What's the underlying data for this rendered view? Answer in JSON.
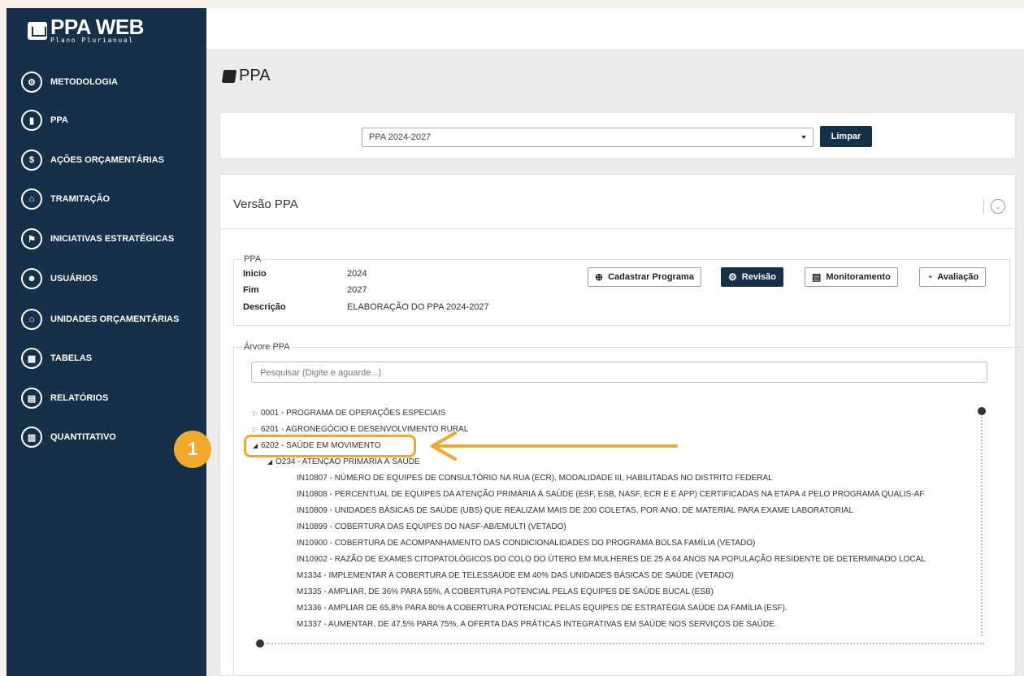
{
  "app": {
    "title": "PPA WEB",
    "subtitle": "Plano Plurianual"
  },
  "sidebar": {
    "items": [
      {
        "label": "METODOLOGIA",
        "icon": "cogs-icon",
        "glyph": "⚙"
      },
      {
        "label": "PPA",
        "icon": "book-icon",
        "glyph": "▮"
      },
      {
        "label": "AÇÕES ORÇAMENTÁRIAS",
        "icon": "dollar-icon",
        "glyph": "$"
      },
      {
        "label": "TRAMITAÇÃO",
        "icon": "inbox-icon",
        "glyph": "⌂"
      },
      {
        "label": "INICIATIVAS ESTRATÉGICAS",
        "icon": "sitemap-icon",
        "glyph": "⚑"
      },
      {
        "label": "USUÁRIOS",
        "icon": "users-icon",
        "glyph": "☻"
      },
      {
        "label": "UNIDADES ORÇAMENTÁRIAS",
        "icon": "bank-icon",
        "glyph": "⌂"
      },
      {
        "label": "TABELAS",
        "icon": "table-icon",
        "glyph": "▦"
      },
      {
        "label": "RELATÓRIOS",
        "icon": "file-icon",
        "glyph": "▤"
      },
      {
        "label": "QUANTITATIVO",
        "icon": "bar-chart-icon",
        "glyph": "▥"
      }
    ]
  },
  "page": {
    "title": "PPA"
  },
  "filter": {
    "selected": "PPA 2024-2027",
    "clear_label": "Limpar"
  },
  "versao": {
    "title": "Versão PPA",
    "buttons": {
      "cadastrar": "Cadastrar Programa",
      "revisao": "Revisão",
      "monitoramento": "Monitoramento",
      "avaliacao": "Avaliação"
    }
  },
  "ppa_info": {
    "legend": "PPA",
    "inicio_label": "Inicio",
    "inicio": "2024",
    "fim_label": "Fim",
    "fim": "2027",
    "descricao_label": "Descrição",
    "descricao": "ELABORAÇÃO DO PPA 2024-2027"
  },
  "tree": {
    "legend": "Árvore PPA",
    "search_placeholder": "Pesquisar (Digite e aguarde...)",
    "nodes": [
      "0001 - PROGRAMA DE OPERAÇÕES ESPECIAIS",
      "6201 - AGRONEGÓCIO E DESENVOLVIMENTO RURAL",
      "6202 - SAÚDE EM MOVIMENTO",
      "O234 - ATENÇÃO PRIMÁRIA À SAÚDE",
      "IN10807 - NÚMERO DE EQUIPES DE CONSULTÓRIO NA RUA (ECR), MODALIDADE III, HABILITADAS NO DISTRITO FEDERAL",
      "IN10808 - PERCENTUAL DE EQUIPES DA ATENÇÃO PRIMÁRIA À SAÚDE (ESF, ESB, NASF, ECR E E APP) CERTIFICADAS NA ETAPA 4 PELO PROGRAMA QUALIS-AF",
      "IN10809 - UNIDADES BÁSICAS DE SAÚDE (UBS) QUE REALIZAM MAIS DE 200 COLETAS, POR ANO, DE MATERIAL PARA EXAME LABORATORIAL",
      "IN10899 - COBERTURA DAS EQUIPES DO NASF-AB/EMULTI (VETADO)",
      "IN10900 - COBERTURA DE ACOMPANHAMENTO DAS CONDICIONALIDADES DO PROGRAMA BOLSA FAMÍLIA (VETADO)",
      "IN10902 - RAZÃO DE EXAMES CITOPATOLÓGICOS DO COLO DO ÚTERO EM MULHERES DE 25 A 64 ANOS NA POPULAÇÃO RESIDENTE DE DETERMINADO LOCAL",
      "M1334 - IMPLEMENTAR A COBERTURA DE TELESSAÚDE EM 40% DAS UNIDADES BÁSICAS DE SAÚDE (VETADO)",
      "M1335 - AMPLIAR, DE 36% PARA 55%, A COBERTURA POTENCIAL PELAS EQUIPES DE SAÚDE BUCAL (ESB)",
      "M1336 - AMPLIAR DE 65,8% PARA 80% A COBERTURA POTENCIAL PELAS EQUIPES DE ESTRATÉGIA SAÚDE DA FAMÍLIA (ESF).",
      "M1337 - AUMENTAR, DE 47,5% PARA 75%, A OFERTA DAS PRÁTICAS INTEGRATIVAS EM SAÚDE NOS SERVIÇOS DE SAÚDE."
    ]
  },
  "callout": {
    "number": "1",
    "color": "#f0a92a"
  },
  "colors": {
    "sidebar": "#17304a",
    "accent": "#f0a92a"
  }
}
